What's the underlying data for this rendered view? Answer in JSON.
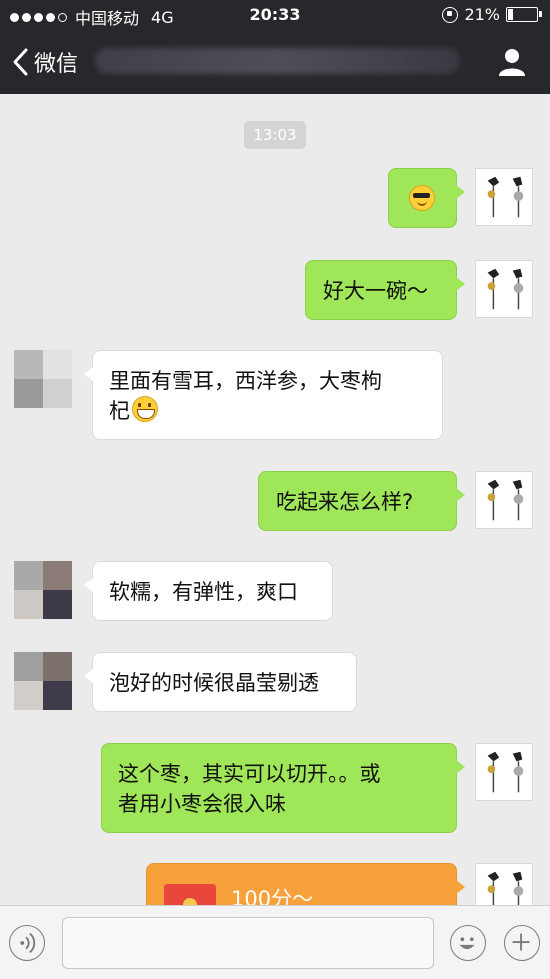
{
  "status_bar": {
    "carrier": "中国移动",
    "network": "4G",
    "time": "20:33",
    "battery": "21%",
    "battery_level": 0.21
  },
  "nav": {
    "back_label": "微信"
  },
  "chat": {
    "timestamp": "13:03",
    "messages": [
      {
        "side": "self",
        "text": ""
      },
      {
        "side": "self",
        "text": "好大一碗～"
      },
      {
        "side": "other",
        "text": "里面有雪耳，西洋参，大枣枸"
      },
      {
        "side": "other",
        "text": "杞"
      },
      {
        "side": "self",
        "text": "吃起来怎么样?"
      },
      {
        "side": "other",
        "text": "软糯，有弹性，爽口"
      },
      {
        "side": "other",
        "text": "泡好的时候很晶莹剔透"
      },
      {
        "side": "self",
        "text": "这个枣，其实可以切开。。或"
      },
      {
        "side": "self",
        "text": "者用小枣会很入味"
      },
      {
        "side": "self",
        "text": "100分～"
      }
    ]
  },
  "input_bar": {
    "message_value": ""
  },
  "colors": {
    "self_bubble": "#9fe658",
    "other_bubble": "#ffffff",
    "red_packet": "#f7a13a",
    "nav_bg": "#26282c",
    "chat_bg": "#ebebeb"
  },
  "icons": [
    "signal-dots-icon",
    "rotation-lock-icon",
    "battery-icon",
    "back-chevron-icon",
    "profile-icon",
    "sunglasses-emoji-icon",
    "grin-emoji-icon",
    "red-packet-icon",
    "voice-icon",
    "emoji-icon",
    "plus-icon"
  ]
}
